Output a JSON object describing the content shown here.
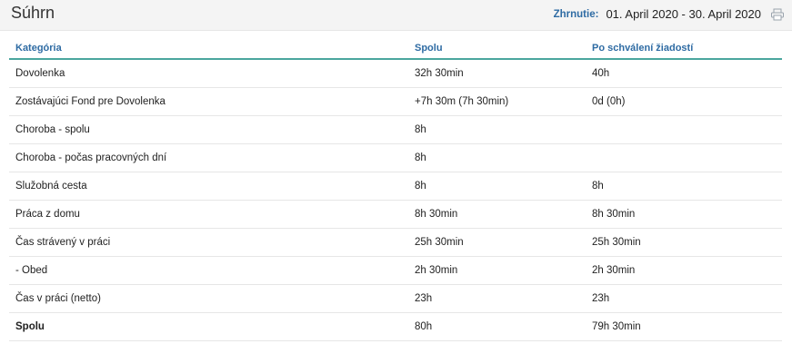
{
  "header": {
    "title": "Súhrn",
    "range_label": "Zhrnutie:",
    "range_value": "01. April 2020 - 30. April 2020",
    "print_icon": "printer-icon"
  },
  "table": {
    "columns": [
      "Kategória",
      "Spolu",
      "Po schválení žiadostí"
    ],
    "rows": [
      [
        "Dovolenka",
        "32h 30min",
        "40h"
      ],
      [
        "Zostávajúci Fond pre Dovolenka",
        "+7h 30m (7h 30min)",
        "0d (0h)"
      ],
      [
        "Choroba - spolu",
        "8h",
        ""
      ],
      [
        "Choroba - počas pracovných dní",
        "8h",
        ""
      ],
      [
        "Služobná cesta",
        "8h",
        "8h"
      ],
      [
        "Práca z domu",
        "8h 30min",
        "8h 30min"
      ],
      [
        "Čas strávený v práci",
        "25h 30min",
        "25h 30min"
      ],
      [
        "- Obed",
        "2h 30min",
        "2h 30min"
      ],
      [
        "Čas v práci (netto)",
        "23h",
        "23h"
      ],
      [
        "Spolu",
        "80h",
        "79h 30min"
      ]
    ]
  },
  "colors": {
    "accent": "#2e6ba3",
    "divider": "#4aa69e"
  }
}
